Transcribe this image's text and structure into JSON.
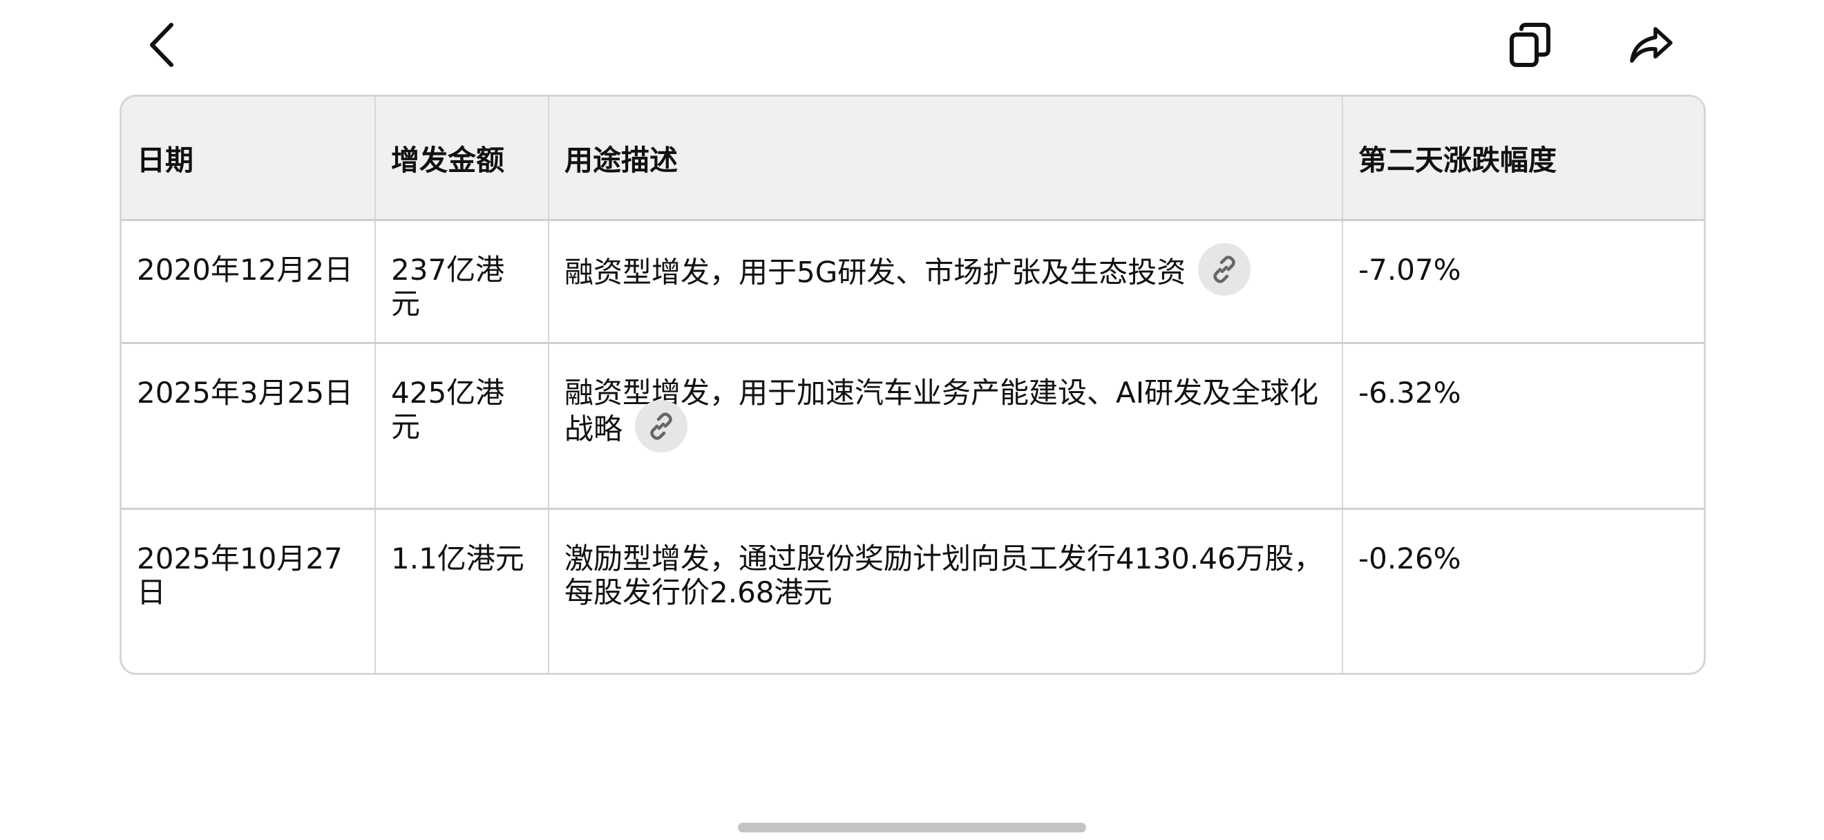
{
  "toolbar": {
    "back_icon": "chevron-left-icon",
    "copy_icon": "copy-icon",
    "share_icon": "share-forward-icon"
  },
  "table": {
    "headers": [
      "日期",
      "增发金额",
      "用途描述",
      "第二天涨跌幅度"
    ],
    "rows": [
      {
        "date": "2020年12月2日",
        "amount": "237亿港元",
        "description": "融资型增发，用于5G研发、市场扩张及生态投资",
        "has_link": true,
        "change": "-7.07%"
      },
      {
        "date": "2025年3月25日",
        "amount": "425亿港元",
        "description": "融资型增发，用于加速汽车业务产能建设、AI研发及全球化战略",
        "has_link": true,
        "change": "-6.32%"
      },
      {
        "date": "2025年10月27日",
        "amount": "1.1亿港元",
        "description": "激励型增发，通过股份奖励计划向员工发行4130.46万股，每股发行价2.68港元",
        "has_link": false,
        "change": "-0.26%"
      }
    ],
    "link_icon": "link-icon"
  },
  "colors": {
    "header_bg": "#f0f0f0",
    "border": "#d6d6d6",
    "chip_bg": "#e6e6e6",
    "text": "#111111"
  }
}
